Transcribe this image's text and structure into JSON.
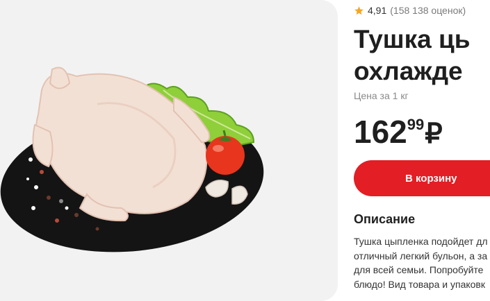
{
  "rating": {
    "value": "4,91",
    "count": "(158 138 оценок)",
    "icon": "star-icon",
    "star_color": "#f5a623"
  },
  "product": {
    "title_line1": "Тушка ць",
    "title_line2": "охлажде",
    "unit_label": "Цена за 1 кг",
    "price_int": "162",
    "price_frac": "99",
    "currency": "₽",
    "image": "product-image-chicken"
  },
  "cart_button": {
    "label": "В корзину",
    "color": "#e31e24"
  },
  "description": {
    "heading": "Описание",
    "lines": [
      "Тушка цыпленка подойдет дл",
      "отличный легкий бульон, а за",
      "для всей семьи. Попробуйте",
      "блюдо! Вид товара и упаковк"
    ]
  }
}
